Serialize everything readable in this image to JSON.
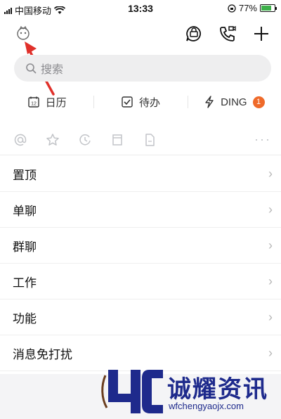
{
  "statusbar": {
    "carrier": "中国移动",
    "time": "13:33",
    "battery": "77%",
    "battery_level": 0.77
  },
  "search": {
    "placeholder": "搜索"
  },
  "quickbar": {
    "items": [
      {
        "label": "日历",
        "icon": "calendar-icon"
      },
      {
        "label": "待办",
        "icon": "todo-icon"
      },
      {
        "label": "DING",
        "icon": "ding-icon",
        "badge": "1"
      }
    ]
  },
  "filters": {
    "icons": [
      "at-icon",
      "star-icon",
      "history-icon",
      "archive-icon",
      "file-icon"
    ],
    "more": "···"
  },
  "menu": {
    "items": [
      {
        "label": "置顶"
      },
      {
        "label": "单聊"
      },
      {
        "label": "群聊"
      },
      {
        "label": "工作"
      },
      {
        "label": "功能"
      },
      {
        "label": "消息免打扰"
      }
    ],
    "chevron": "›"
  },
  "watermark": {
    "title": "诚耀资讯",
    "url": "wfchengyaojx.com"
  },
  "colors": {
    "accent_badge": "#ef6a2a",
    "arrow": "#e0302a",
    "watermark": "#1e2a8c",
    "battery_fill": "#3db04a"
  }
}
